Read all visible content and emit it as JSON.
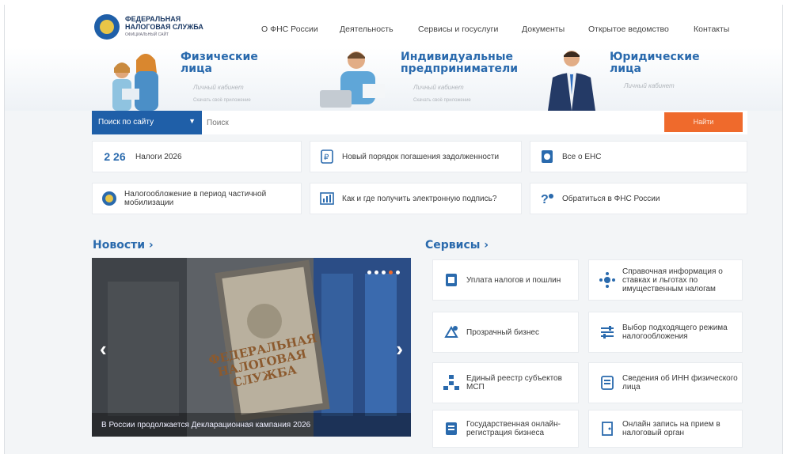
{
  "header": {
    "logo_line1": "ФЕДЕРАЛЬНАЯ",
    "logo_line2": "НАЛОГОВАЯ СЛУЖБА",
    "logo_sub": "ОФИЦИАЛЬНЫЙ САЙТ",
    "nav": [
      "О ФНС России",
      "Деятельность",
      "Сервисы и госуслуги",
      "Документы",
      "Открытое ведомство",
      "Контакты"
    ]
  },
  "segments": [
    {
      "title1": "Физические",
      "title2": "лица",
      "link": "Личный кабинет",
      "sub": "Скачать своё приложение"
    },
    {
      "title1": "Индивидуальные",
      "title2": "предприниматели",
      "link": "Личный кабинет",
      "sub": "Скачать своё приложение"
    },
    {
      "title1": "Юридические",
      "title2": "лица",
      "link": "Личный кабинет"
    }
  ],
  "search": {
    "select_label": "Поиск по сайту",
    "placeholder": "Поиск",
    "button_label": "Найти"
  },
  "tiles": [
    {
      "label": "Налоги 2026",
      "badge": "2 26"
    },
    {
      "label": "Новый порядок погашения задолженности"
    },
    {
      "label": "Все о ЕНС"
    },
    {
      "label": "Налогообложение в период частичной мобилизации"
    },
    {
      "label": "Как и где получить электронную подпись?"
    },
    {
      "label": "Обратиться в ФНС России"
    }
  ],
  "news": {
    "title": "Новости ›",
    "caption": "В России продолжается Декларационная кампания 2026",
    "sign_text": "ФЕДЕРАЛЬНАЯ НАЛОГОВАЯ СЛУЖБА"
  },
  "services": {
    "title": "Сервисы ›",
    "items": [
      "Уплата налогов и пошлин",
      "Справочная информация о ставках и льготах по имущественным налогам",
      "Прозрачный бизнес",
      "Выбор подходящего режима налогообложения",
      "Единый реестр субъектов МСП",
      "Сведения об ИНН физического лица",
      "Государственная онлайн-регистрация бизнеса",
      "Онлайн запись на прием в налоговый орган"
    ]
  },
  "colors": {
    "brand": "#1f5fa8",
    "accent": "#ef6a2c",
    "title": "#2a6aad"
  }
}
